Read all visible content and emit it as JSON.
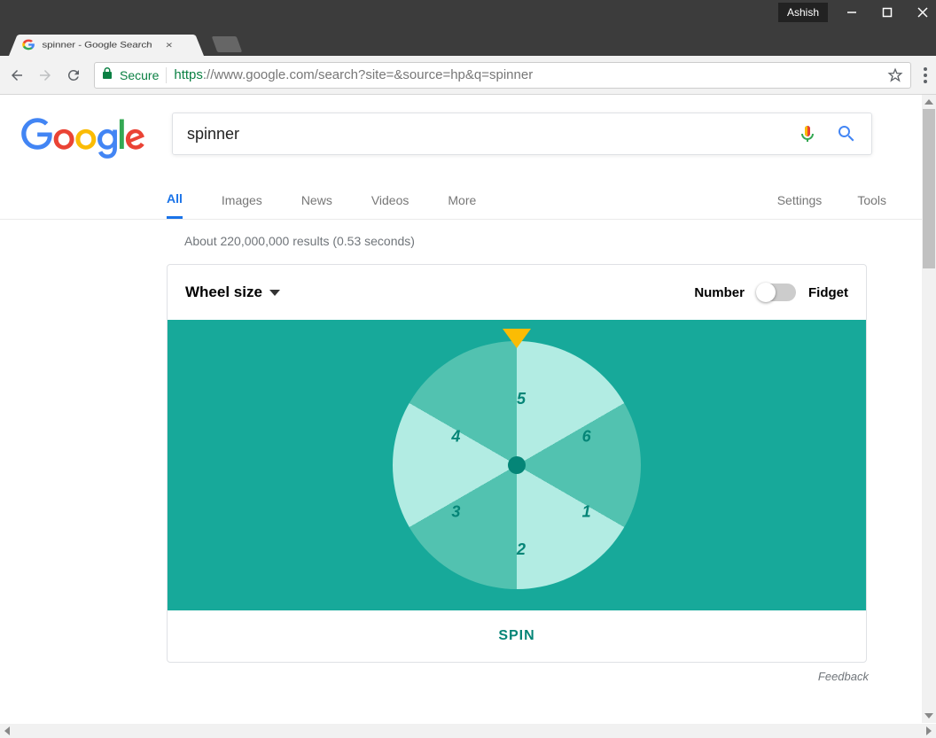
{
  "window": {
    "user": "Ashish"
  },
  "tab": {
    "title": "spinner - Google Search"
  },
  "address": {
    "secure_label": "Secure",
    "protocol": "https",
    "host": "://www.google.com",
    "path": "/search?site=&source=hp&q=spinner"
  },
  "search": {
    "query": "spinner"
  },
  "nav": {
    "all": "All",
    "images": "Images",
    "news": "News",
    "videos": "Videos",
    "more": "More",
    "settings": "Settings",
    "tools": "Tools"
  },
  "stats": "About 220,000,000 results (0.53 seconds)",
  "spinner": {
    "wheel_size_label": "Wheel size",
    "number_label": "Number",
    "fidget_label": "Fidget",
    "segments": [
      "1",
      "2",
      "3",
      "4",
      "5",
      "6"
    ],
    "spin_label": "SPIN"
  },
  "feedback": "Feedback"
}
